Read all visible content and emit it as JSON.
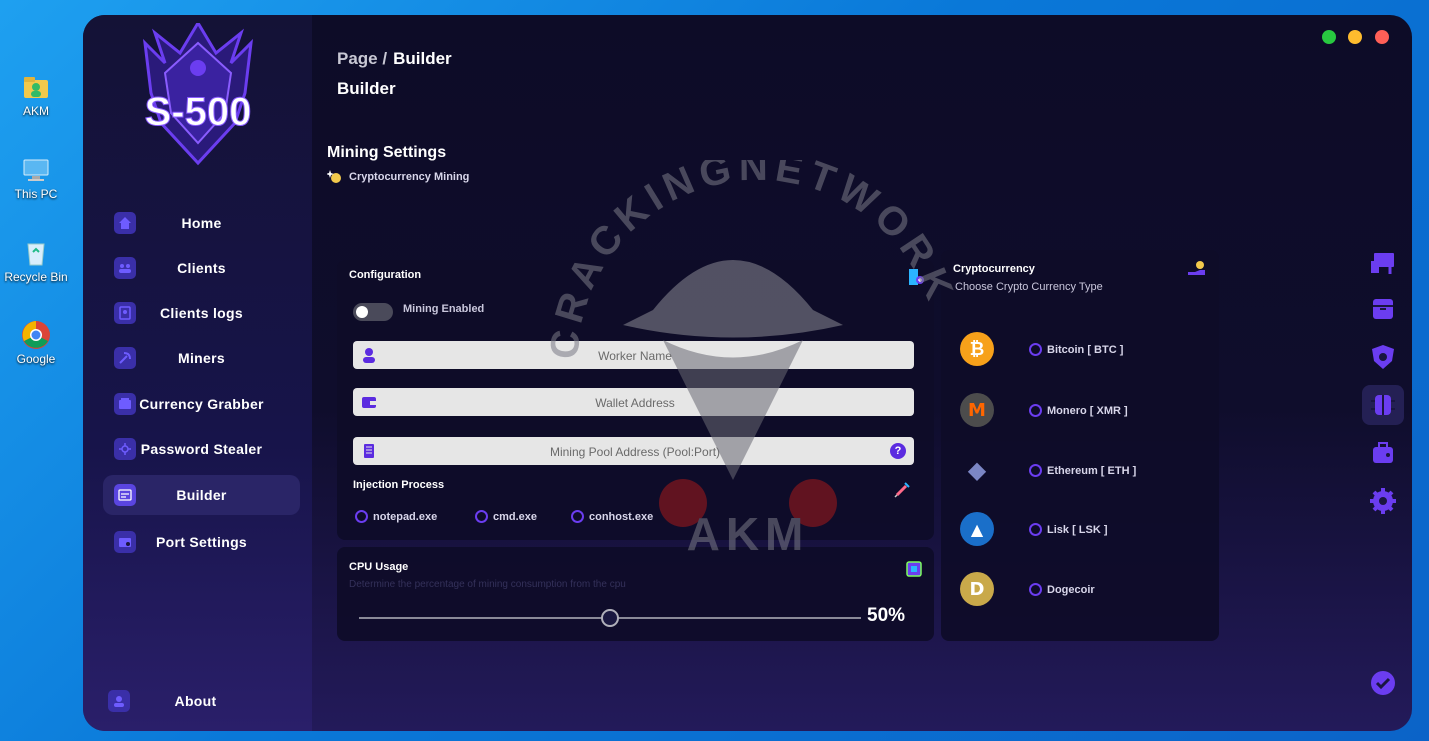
{
  "desktop": {
    "icons": [
      {
        "label": "AKM"
      },
      {
        "label": "This PC"
      },
      {
        "label": "Recycle Bin"
      },
      {
        "label": "Google"
      }
    ]
  },
  "app": {
    "logo_text": "S-500",
    "breadcrumb": {
      "prefix": "Page /",
      "current": "Builder"
    },
    "page_title": "Builder",
    "window_controls": {
      "colors": [
        "#28c940",
        "#febc2e",
        "#ff5f57"
      ]
    }
  },
  "sidebar": {
    "items": [
      {
        "label": "Home",
        "icon": "home-icon"
      },
      {
        "label": "Clients",
        "icon": "clients-icon"
      },
      {
        "label": "Clients logs",
        "icon": "clients-logs-icon"
      },
      {
        "label": "Miners",
        "icon": "miners-icon"
      },
      {
        "label": "Currency Grabber",
        "icon": "wallet-icon"
      },
      {
        "label": "Password Stealer",
        "icon": "key-icon"
      },
      {
        "label": "Builder",
        "icon": "builder-icon",
        "active": true
      },
      {
        "label": "Port Settings",
        "icon": "port-settings-icon"
      }
    ],
    "about_label": "About"
  },
  "mining": {
    "title": "Mining Settings",
    "subtitle": "Cryptocurrency Mining",
    "watermark_text": "CRACKINGNETWORK",
    "watermark_sign": "AKM"
  },
  "configuration": {
    "title": "Configuration",
    "toggle_label": "Mining Enabled",
    "worker_placeholder": "Worker Name",
    "wallet_placeholder": "Wallet Address",
    "pool_placeholder": "Mining Pool Address (Pool:Port)",
    "help_glyph": "?",
    "injection_title": "Injection Process",
    "processes": [
      "notepad.exe",
      "cmd.exe",
      "conhost.exe"
    ]
  },
  "cpu": {
    "title": "CPU Usage",
    "description": "Determine the percentage of mining consumption from the cpu",
    "value_label": "50%",
    "value": 0.5
  },
  "crypto": {
    "title": "Cryptocurrency",
    "subtitle": "Choose Crypto Currency Type",
    "coins": [
      {
        "label": "Bitcoin [ BTC ]",
        "glyph": "₿",
        "color": "#f7a11a"
      },
      {
        "label": "Monero [ XMR ]",
        "glyph": "M",
        "color": "#ff6600"
      },
      {
        "label": "Ethereum [ ETH ]",
        "glyph": "◆",
        "color": "#7b86c4"
      },
      {
        "label": "Lisk [ LSK ]",
        "glyph": "▲",
        "color": "#1a6fc9"
      },
      {
        "label": "Dogecoir",
        "glyph": "D",
        "color": "#c9a94a"
      }
    ]
  },
  "colors": {
    "accent": "#5b2be0",
    "text": "#ffffff"
  }
}
